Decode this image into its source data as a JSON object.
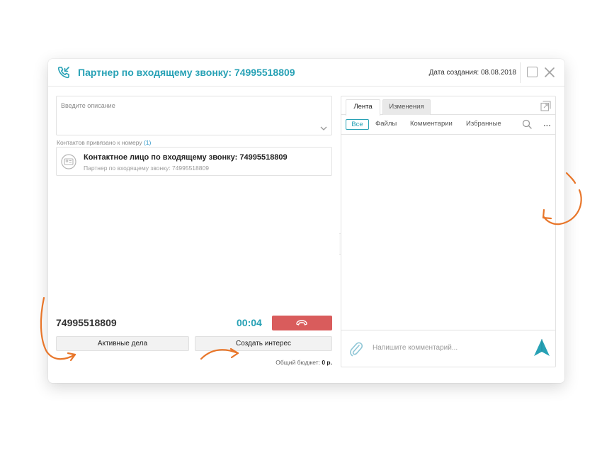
{
  "header": {
    "title": "Партнер по входящему звонку: 74995518809",
    "created_label": "Дата создания:",
    "created_value": "08.08.2018",
    "icons": [
      "phone-incoming-icon",
      "maximize-icon",
      "close-icon"
    ]
  },
  "left": {
    "description_placeholder": "Введите описание",
    "contacts_label": "Контактов привязано к номеру",
    "contacts_count": "(1)",
    "contact": {
      "name": "Контактное лицо по входящему звонку: 74995518809",
      "subtitle": "Партнер по входящему звонку: 74995518809"
    },
    "phone_number": "74995518809",
    "timer": "00:04",
    "buttons": {
      "active_tasks": "Активные дела",
      "create_interest": "Создать интерес"
    },
    "budget_label": "Общий бюджет:",
    "budget_value": "0 р."
  },
  "right": {
    "tabs": [
      {
        "label": "Лента",
        "active": true
      },
      {
        "label": "Изменения",
        "active": false
      }
    ],
    "filters": [
      {
        "label": "Все",
        "active": true
      },
      {
        "label": "Файлы",
        "active": false
      },
      {
        "label": "Комментарии",
        "active": false
      },
      {
        "label": "Избранные",
        "active": false
      }
    ],
    "more_label": "...",
    "comment_placeholder": "Напишите комментарий..."
  },
  "colors": {
    "accent": "#27a1b5",
    "hangup": "#d95c5c",
    "annotation": "#e8762a",
    "link": "#2a94c7"
  }
}
